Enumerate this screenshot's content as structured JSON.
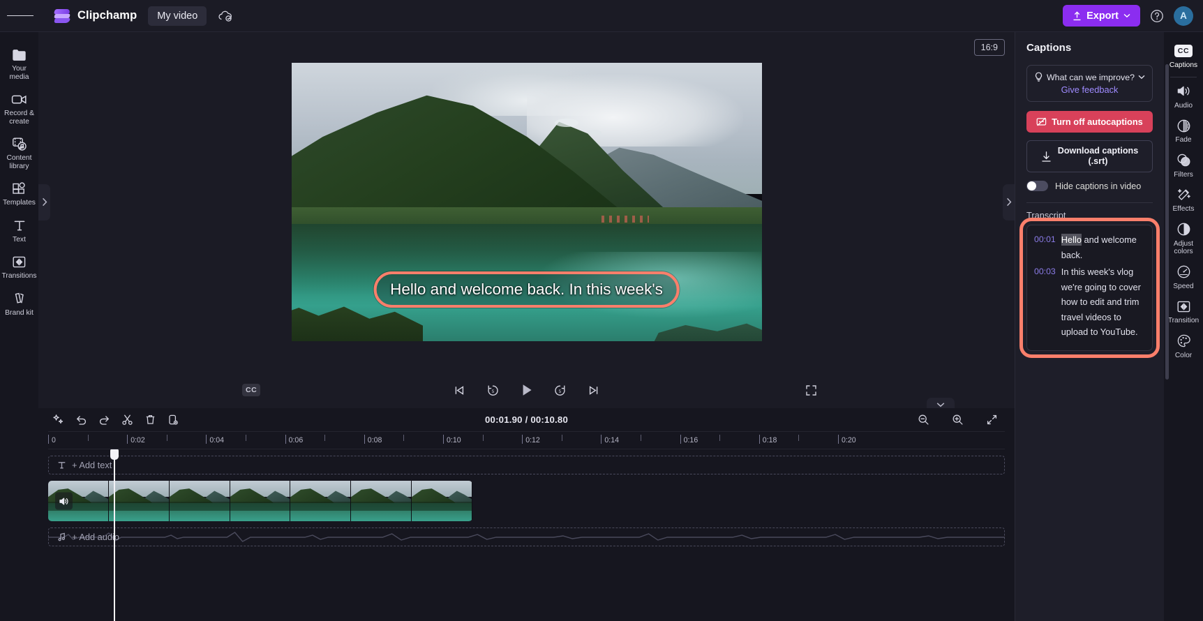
{
  "app": {
    "brand_name": "Clipchamp",
    "project_name": "My video",
    "menu_icon": "hamburger-icon",
    "cloud_icon": "cloud-saved-icon"
  },
  "topbar": {
    "export_label": "Export",
    "export_color": "#8b2df0",
    "help_icon": "help-circle-icon",
    "avatar_initial": "A"
  },
  "left_rail": {
    "items": [
      {
        "label": "Your media",
        "icon": "media-folder-icon"
      },
      {
        "label": "Record &\ncreate",
        "label_line1": "Record &",
        "label_line2": "create",
        "icon": "video-camera-icon"
      },
      {
        "label": "Content\nlibrary",
        "label_line1": "Content",
        "label_line2": "library",
        "icon": "content-library-icon"
      },
      {
        "label": "Templates",
        "icon": "templates-icon"
      },
      {
        "label": "Text",
        "icon": "text-icon"
      },
      {
        "label": "Transitions",
        "icon": "transitions-icon"
      },
      {
        "label": "Brand kit",
        "icon": "brand-kit-icon"
      }
    ]
  },
  "preview": {
    "aspect_ratio": "16:9",
    "caption_text": "Hello and welcome back. In this week's",
    "caption_border_color": "#fa7f6b",
    "cc_label": "CC",
    "collapse_left_icon": "chevron-left-icon",
    "collapse_right_icon": "chevron-right-icon",
    "fullscreen_icon": "fullscreen-icon",
    "transport": [
      {
        "icon": "skip-previous-icon",
        "name": "previous-frame-button"
      },
      {
        "icon": "rewind-5s-icon",
        "name": "rewind-5-seconds-button"
      },
      {
        "icon": "play-icon",
        "name": "play-button"
      },
      {
        "icon": "forward-5s-icon",
        "name": "forward-5-seconds-button"
      },
      {
        "icon": "skip-next-icon",
        "name": "next-frame-button"
      }
    ]
  },
  "timeline": {
    "tools": [
      {
        "icon": "magic-wand-icon",
        "name": "auto-compose-button"
      },
      {
        "icon": "undo-icon",
        "name": "undo-button"
      },
      {
        "icon": "redo-icon",
        "name": "redo-button"
      },
      {
        "icon": "scissors-icon",
        "name": "split-button"
      },
      {
        "icon": "trash-icon",
        "name": "delete-button"
      },
      {
        "icon": "duplicate-icon",
        "name": "duplicate-button"
      }
    ],
    "current_time": "00:01.90",
    "total_time": "00:10.80",
    "time_separator": "/",
    "zoom_out_icon": "zoom-out-icon",
    "zoom_in_icon": "zoom-in-icon",
    "fit_icon": "fit-to-timeline-icon",
    "ruler_labels": [
      "0",
      "0:02",
      "0:04",
      "0:06",
      "0:08",
      "0:10",
      "0:12",
      "0:14",
      "0:16",
      "0:18",
      "0:20"
    ],
    "add_text_label": "+ Add text",
    "add_audio_label": "+ Add audio",
    "text_track_icon": "text-icon",
    "audio_track_icon": "music-note-icon",
    "clip_audio_icon": "speaker-icon",
    "playhead_position_label": "00:01.90",
    "collapse_icon": "chevron-down-icon"
  },
  "captions_panel": {
    "title": "Captions",
    "feedback_question": "What can we improve?",
    "feedback_link": "Give feedback",
    "feedback_icon": "lightbulb-icon",
    "feedback_chevron": "chevron-down-icon",
    "turn_off_label": "Turn off autocaptions",
    "turn_off_icon": "captions-off-icon",
    "turn_off_color": "#d8415a",
    "download_label_line1": "Download captions",
    "download_label_line2": "(.srt)",
    "download_icon": "download-icon",
    "hide_captions_label": "Hide captions in video",
    "hide_captions_on": false,
    "transcript_label": "Transcript",
    "transcript_highlight_color": "#fa7f6b",
    "transcript": [
      {
        "time": "00:01",
        "highlighted_word": "Hello",
        "rest": " and welcome back."
      },
      {
        "time": "00:03",
        "highlighted_word": "",
        "rest": "In this week's vlog we're going to cover how to edit and trim travel videos to upload to YouTube."
      }
    ]
  },
  "right_rail": {
    "items": [
      {
        "label": "Captions",
        "icon": "cc-icon",
        "active": true
      },
      {
        "label": "Audio",
        "icon": "speaker-icon"
      },
      {
        "label": "Fade",
        "icon": "fade-icon"
      },
      {
        "label": "Filters",
        "icon": "filters-icon"
      },
      {
        "label": "Effects",
        "icon": "effects-wand-icon"
      },
      {
        "label": "Adjust\ncolors",
        "label_line1": "Adjust",
        "label_line2": "colors",
        "icon": "adjust-colors-icon"
      },
      {
        "label": "Speed",
        "icon": "speedometer-icon"
      },
      {
        "label": "Transition",
        "icon": "transitions-icon"
      },
      {
        "label": "Color",
        "icon": "color-palette-icon"
      }
    ]
  }
}
